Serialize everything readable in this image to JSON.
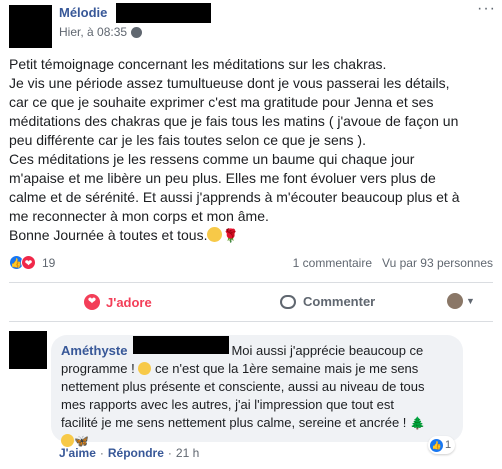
{
  "post": {
    "author": "Mélodie",
    "timestamp": "Hier, à 08:35",
    "more": "···",
    "text_lines": [
      "Petit témoignage concernant les méditations sur les chakras.",
      "Je vis une période assez tumultueuse dont je vous passerai les détails,",
      "car ce que je souhaite exprimer c'est ma gratitude pour Jenna et ses",
      "méditations des chakras que je fais tous les matins ( j'avoue de façon un",
      "peu différente car je les fais toutes selon ce que je sens ).",
      "Ces méditations je les ressens comme un baume qui chaque jour",
      "m'apaise et me libère un peu plus. Elles me font évoluer vers plus de",
      "calme et de sérénité. Et aussi j'apprends à m'écouter beaucoup plus et à",
      "me reconnecter à mon corps et mon âme.",
      "Bonne Journée à toutes et tous."
    ],
    "emoji_end": "🌹"
  },
  "stats": {
    "reactions_count": "19",
    "comments": "1 commentaire",
    "views": "Vu par 93 personnes"
  },
  "actions": {
    "love_label": "J'adore",
    "comment_label": "Commenter"
  },
  "comment": {
    "author": "Améthyste",
    "lines": [
      "Moi aussi j'apprécie beaucoup ce",
      "programme !",
      "ce n'est que la 1ère semaine mais je me sens",
      "nettement plus présente et consciente, aussi au niveau de tous",
      "mes rapports avec les autres, j'ai l'impression que tout est",
      "facilité je me sens nettement plus calme, sereine et ancrée !"
    ],
    "reaction_count": "1",
    "like_label": "J'aime",
    "reply_label": "Répondre",
    "age": "21 h"
  },
  "icons": {
    "like": "👍",
    "love": "❤",
    "tree": "🌲",
    "butterfly": "🦋"
  },
  "colors": {
    "link_blue": "#385898",
    "love_red": "#f33e58",
    "like_blue": "#1877f2"
  }
}
